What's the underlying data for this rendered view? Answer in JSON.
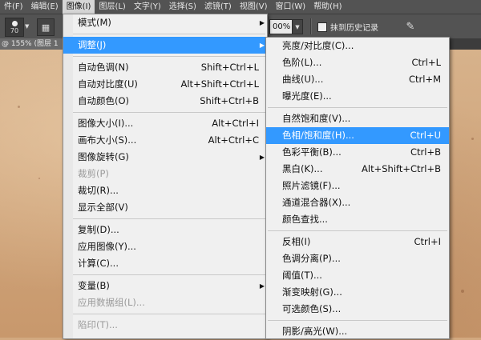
{
  "menubar": {
    "items": [
      {
        "label": "件(F)"
      },
      {
        "label": "编辑(E)"
      },
      {
        "label": "图像(I)",
        "active": true
      },
      {
        "label": "图层(L)"
      },
      {
        "label": "文字(Y)"
      },
      {
        "label": "选择(S)"
      },
      {
        "label": "滤镜(T)"
      },
      {
        "label": "视图(V)"
      },
      {
        "label": "窗口(W)"
      },
      {
        "label": "帮助(H)"
      }
    ]
  },
  "options_bar": {
    "brush_size": "70",
    "opacity_value": "00%",
    "history_label": "抹到历史记录",
    "history_checked": false
  },
  "document_tab": {
    "label": "@ 155% (图层 1"
  },
  "image_menu": {
    "items": [
      {
        "type": "item",
        "label": "模式(M)",
        "submenu": true
      },
      {
        "type": "sep"
      },
      {
        "type": "item",
        "label": "调整(J)",
        "submenu": true,
        "highlighted": true
      },
      {
        "type": "sep"
      },
      {
        "type": "item",
        "label": "自动色调(N)",
        "shortcut": "Shift+Ctrl+L"
      },
      {
        "type": "item",
        "label": "自动对比度(U)",
        "shortcut": "Alt+Shift+Ctrl+L"
      },
      {
        "type": "item",
        "label": "自动颜色(O)",
        "shortcut": "Shift+Ctrl+B"
      },
      {
        "type": "sep"
      },
      {
        "type": "item",
        "label": "图像大小(I)...",
        "shortcut": "Alt+Ctrl+I"
      },
      {
        "type": "item",
        "label": "画布大小(S)...",
        "shortcut": "Alt+Ctrl+C"
      },
      {
        "type": "item",
        "label": "图像旋转(G)",
        "submenu": true
      },
      {
        "type": "item",
        "label": "裁剪(P)",
        "disabled": true
      },
      {
        "type": "item",
        "label": "裁切(R)..."
      },
      {
        "type": "item",
        "label": "显示全部(V)"
      },
      {
        "type": "sep"
      },
      {
        "type": "item",
        "label": "复制(D)..."
      },
      {
        "type": "item",
        "label": "应用图像(Y)..."
      },
      {
        "type": "item",
        "label": "计算(C)..."
      },
      {
        "type": "sep"
      },
      {
        "type": "item",
        "label": "变量(B)",
        "submenu": true
      },
      {
        "type": "item",
        "label": "应用数据组(L)...",
        "disabled": true
      },
      {
        "type": "sep"
      },
      {
        "type": "item",
        "label": "陷印(T)...",
        "disabled": true
      }
    ]
  },
  "adjust_menu": {
    "items": [
      {
        "type": "item",
        "label": "亮度/对比度(C)..."
      },
      {
        "type": "item",
        "label": "色阶(L)...",
        "shortcut": "Ctrl+L"
      },
      {
        "type": "item",
        "label": "曲线(U)...",
        "shortcut": "Ctrl+M"
      },
      {
        "type": "item",
        "label": "曝光度(E)..."
      },
      {
        "type": "sep"
      },
      {
        "type": "item",
        "label": "自然饱和度(V)..."
      },
      {
        "type": "item",
        "label": "色相/饱和度(H)...",
        "shortcut": "Ctrl+U",
        "highlighted": true
      },
      {
        "type": "item",
        "label": "色彩平衡(B)...",
        "shortcut": "Ctrl+B"
      },
      {
        "type": "item",
        "label": "黑白(K)...",
        "shortcut": "Alt+Shift+Ctrl+B"
      },
      {
        "type": "item",
        "label": "照片滤镜(F)..."
      },
      {
        "type": "item",
        "label": "通道混合器(X)..."
      },
      {
        "type": "item",
        "label": "颜色查找..."
      },
      {
        "type": "sep"
      },
      {
        "type": "item",
        "label": "反相(I)",
        "shortcut": "Ctrl+I"
      },
      {
        "type": "item",
        "label": "色调分离(P)..."
      },
      {
        "type": "item",
        "label": "阈值(T)..."
      },
      {
        "type": "item",
        "label": "渐变映射(G)..."
      },
      {
        "type": "item",
        "label": "可选颜色(S)..."
      },
      {
        "type": "sep"
      },
      {
        "type": "item",
        "label": "阴影/高光(W)..."
      }
    ]
  },
  "colors": {
    "highlight": "#3399ff",
    "chrome": "#535353",
    "menu_bg": "#f0f0f0"
  }
}
